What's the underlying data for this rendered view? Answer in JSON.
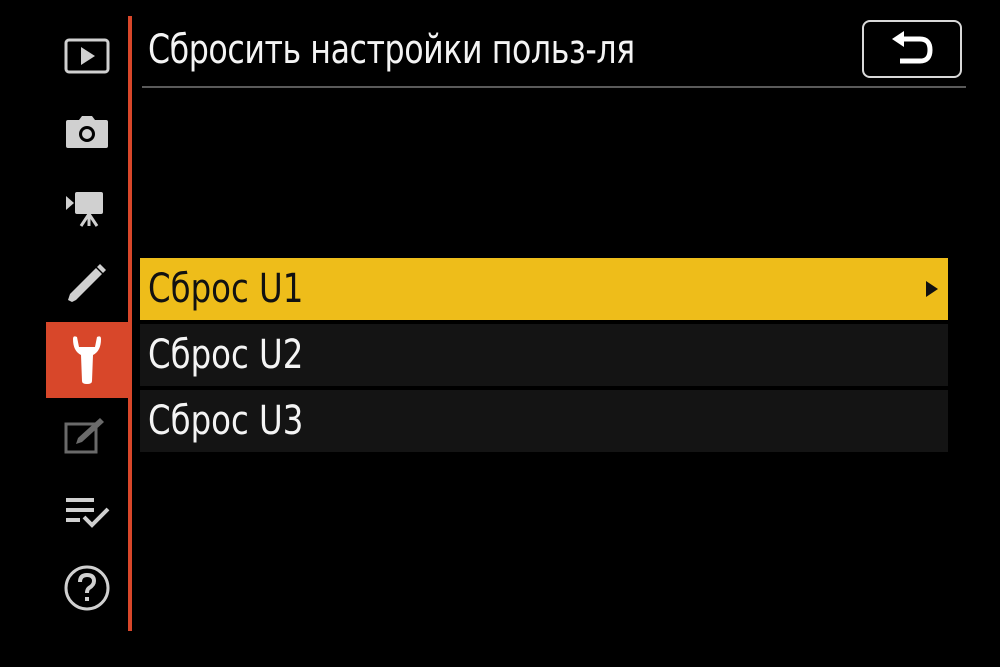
{
  "screen": {
    "title": "Сбросить настройки польз-ля"
  },
  "sidebar": {
    "items": [
      {
        "icon": "playback-icon",
        "active": false
      },
      {
        "icon": "camera-icon",
        "active": false
      },
      {
        "icon": "movie-camera-icon",
        "active": false
      },
      {
        "icon": "pencil-icon",
        "active": false
      },
      {
        "icon": "wrench-icon",
        "active": true
      },
      {
        "icon": "retouch-icon",
        "active": false
      },
      {
        "icon": "my-menu-icon",
        "active": false
      },
      {
        "icon": "help-icon",
        "active": false
      }
    ],
    "accent_color": "#d8472a"
  },
  "header": {
    "back_icon": "return-icon"
  },
  "menu": {
    "items": [
      {
        "label": "Сброс U1",
        "selected": true
      },
      {
        "label": "Сброс U2",
        "selected": false
      },
      {
        "label": "Сброс U3",
        "selected": false
      }
    ],
    "selected_color": "#eebd1a"
  }
}
